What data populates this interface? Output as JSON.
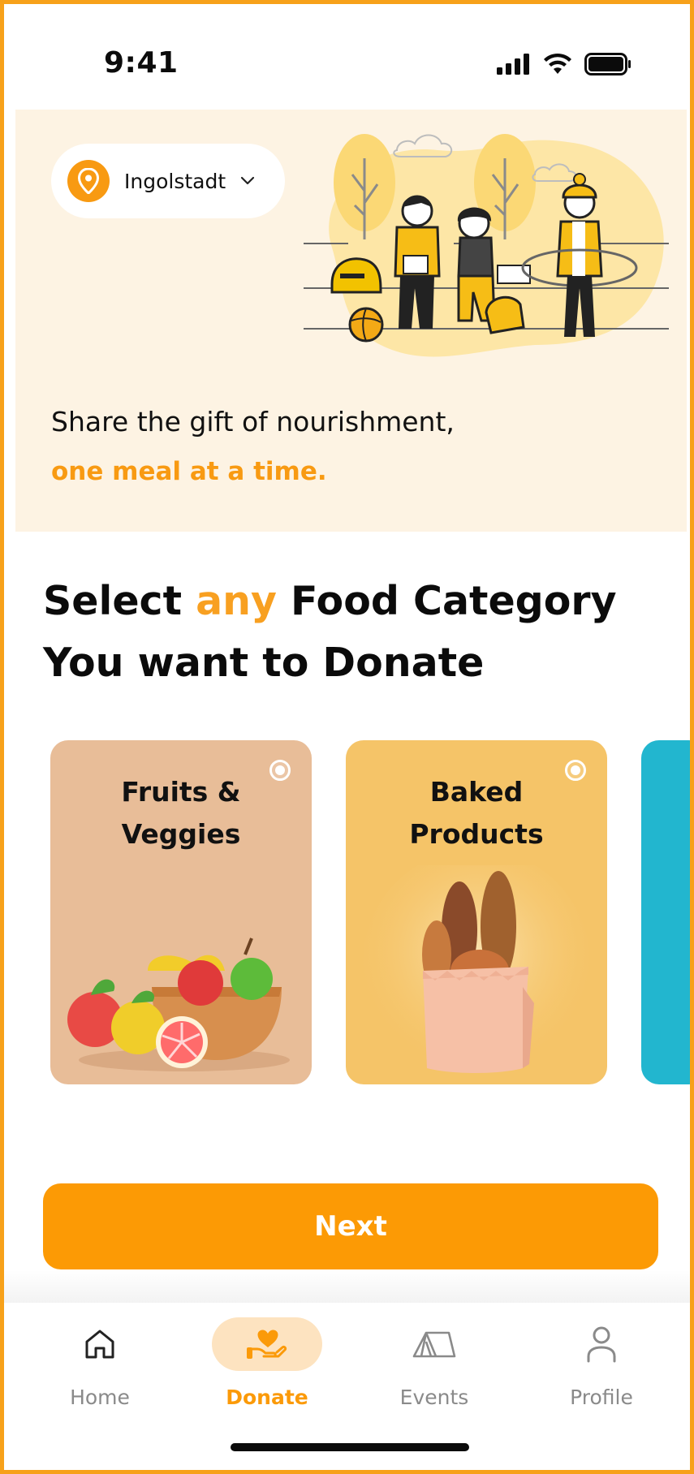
{
  "status_bar": {
    "time": "9:41"
  },
  "location": {
    "city": "Ingolstadt"
  },
  "hero": {
    "line1": "Share the gift of nourishment,",
    "line2": "one meal at a time."
  },
  "heading": {
    "part1": "Select ",
    "accent": "any",
    "part2": " Food Category",
    "line2": "You want to Donate"
  },
  "categories": [
    {
      "title": "Fruits &\nVeggies",
      "selected": false
    },
    {
      "title": "Baked\nProducts",
      "selected": false
    }
  ],
  "next_button": {
    "label": "Next"
  },
  "bottom_nav": {
    "items": [
      {
        "label": "Home",
        "icon": "home-icon",
        "active": false
      },
      {
        "label": "Donate",
        "icon": "donate-hand-heart-icon",
        "active": true
      },
      {
        "label": "Events",
        "icon": "tent-icon",
        "active": false
      },
      {
        "label": "Profile",
        "icon": "person-icon",
        "active": false
      }
    ]
  },
  "colors": {
    "accent": "#f89a12",
    "hero_bg": "#fdf3e3",
    "fruits_card": "#e8bd98",
    "baked_card": "#f5c468",
    "third_card": "#22b6cf",
    "button": "#fc9a05"
  }
}
